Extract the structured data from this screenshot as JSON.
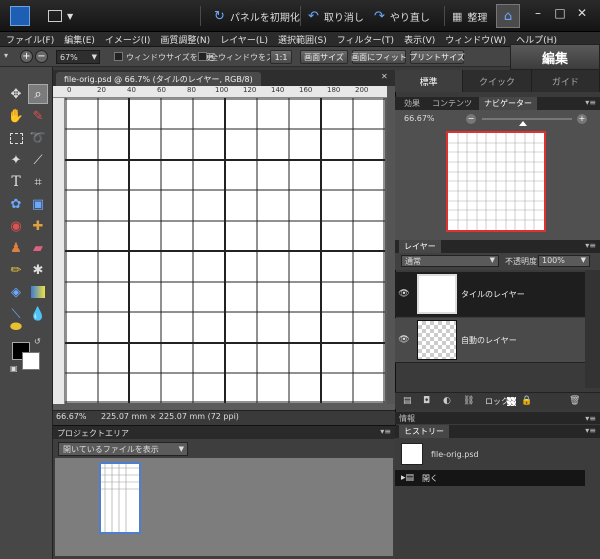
{
  "titlebar": {
    "reset_panels": "パネルを初期化",
    "undo": "取り消し",
    "redo": "やり直し",
    "organize": "整理"
  },
  "menu": [
    "ファイル(F)",
    "編集(E)",
    "イメージ(I)",
    "画質調整(N)",
    "レイヤー(L)",
    "選択範囲(S)",
    "フィルター(T)",
    "表示(V)",
    "ウィンドウ(W)",
    "ヘルプ(H)"
  ],
  "options": {
    "zoom": "67%",
    "resize_window": "ウィンドウサイズを変更",
    "zoom_all": "全ウィンドウをズーム",
    "actual": "1:1",
    "screen_size": "画面サイズ",
    "fit_screen": "画面にフィット",
    "print_size": "プリントサイズ"
  },
  "edit_mode": "編集",
  "mode_tabs": [
    "標準",
    "クイック",
    "ガイド"
  ],
  "document": {
    "tab_title": "file-orig.psd @ 66.7% (タイルのレイヤー, RGB/8)",
    "ruler_labels": [
      "0",
      "20",
      "40",
      "60",
      "80",
      "100",
      "120",
      "140",
      "160",
      "180",
      "200"
    ],
    "status_zoom": "66.67%",
    "status_size": "225.07 mm × 225.07 mm (72 ppi)"
  },
  "project": {
    "header": "プロジェクトエリア",
    "dropdown": "開いているファイルを表示"
  },
  "navigator": {
    "tabs": [
      "効果",
      "コンテンツ",
      "ナビゲーター"
    ],
    "zoom": "66.67%",
    "zoom_fraction": 0.45
  },
  "layers": {
    "header": "レイヤー",
    "blend_mode": "通常",
    "opacity_label": "不透明度:",
    "opacity": "100%",
    "items": [
      {
        "name": "タイルのレイヤー",
        "active": true
      },
      {
        "name": "自動のレイヤー",
        "active": false
      }
    ],
    "lock_label": "ロック:"
  },
  "info": {
    "header": "情報"
  },
  "history": {
    "header": "ヒストリー",
    "items": [
      "file-orig.psd",
      "開く"
    ]
  },
  "colors": {
    "foreground": "#000000",
    "background": "#ffffff",
    "highlight": "#4d7fd1",
    "nav_frame": "#e03030"
  }
}
